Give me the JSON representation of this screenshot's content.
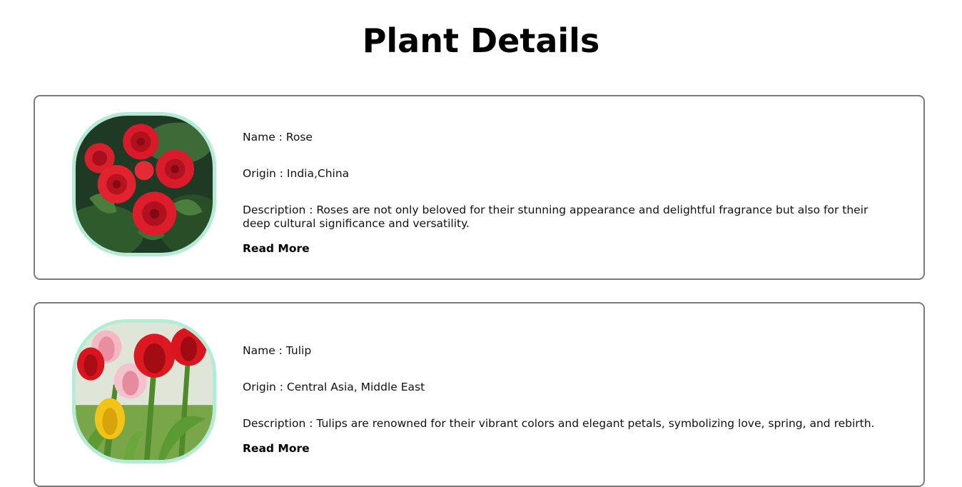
{
  "page": {
    "title": "Plant Details"
  },
  "plants": [
    {
      "name_line": "Name : Rose",
      "origin_line": "Origin : India,China",
      "description_line": "Description : Roses are not only beloved for their stunning appearance and delightful fragrance but also for their deep cultural significance and versatility.",
      "read_more": "Read More",
      "photo_icon": "rose-photo"
    },
    {
      "name_line": "Name : Tulip",
      "origin_line": "Origin : Central Asia, Middle East",
      "description_line": "Description : Tulips are renowned for their vibrant colors and elegant petals, symbolizing love, spring, and rebirth.",
      "read_more": "Read More",
      "photo_icon": "tulip-photo"
    }
  ],
  "colors": {
    "card_border": "#7a7a7a",
    "photo_border": "#b5ebd4",
    "text": "#111111"
  }
}
